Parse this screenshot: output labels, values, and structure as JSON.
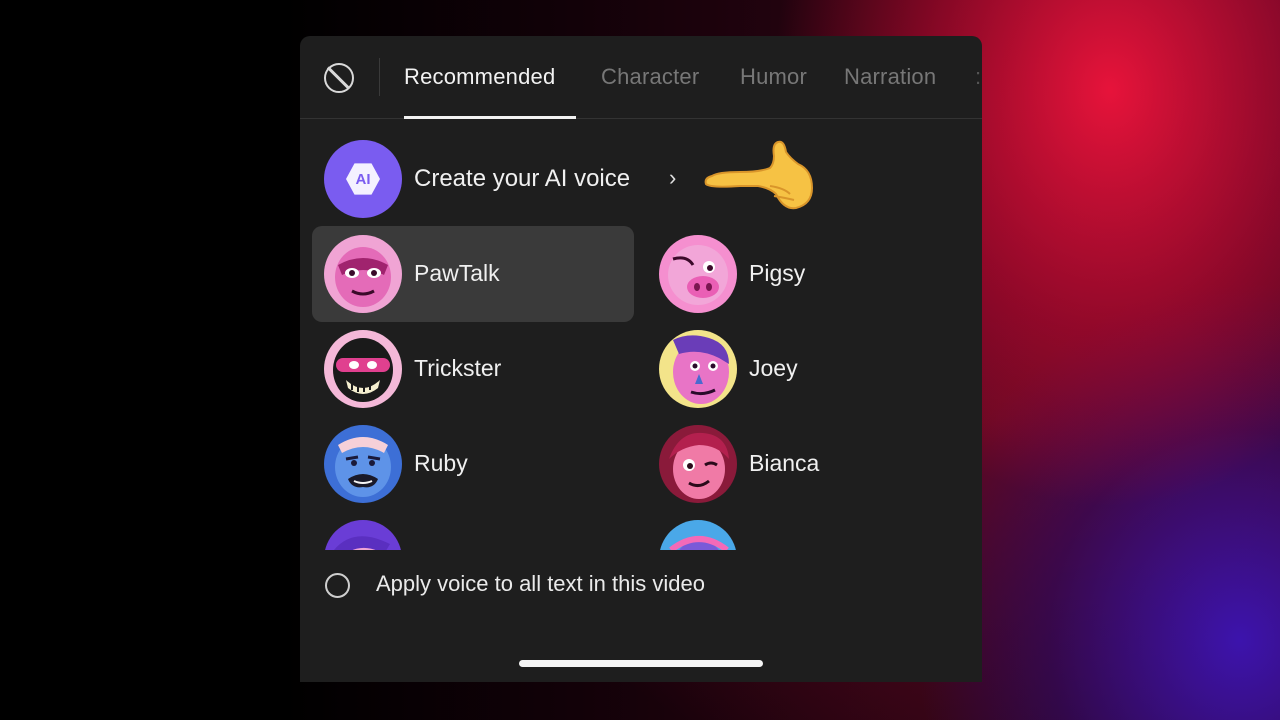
{
  "tabs": {
    "items": [
      {
        "label": "Recommended",
        "active": true
      },
      {
        "label": "Character",
        "active": false
      },
      {
        "label": "Humor",
        "active": false
      },
      {
        "label": "Narration",
        "active": false
      }
    ],
    "more_glyph": ":"
  },
  "ai_voice": {
    "badge": "AI",
    "label": "Create your AI voice",
    "chevron": "›",
    "accent": "#7a5cf0"
  },
  "voices": [
    {
      "label": "PawTalk",
      "selected": true,
      "icon": "pawtalk-avatar-icon"
    },
    {
      "label": "Pigsy",
      "selected": false,
      "icon": "pigsy-avatar-icon"
    },
    {
      "label": "Trickster",
      "selected": false,
      "icon": "trickster-avatar-icon"
    },
    {
      "label": "Joey",
      "selected": false,
      "icon": "joey-avatar-icon"
    },
    {
      "label": "Ruby",
      "selected": false,
      "icon": "ruby-avatar-icon"
    },
    {
      "label": "Bianca",
      "selected": false,
      "icon": "bianca-avatar-icon"
    }
  ],
  "apply_all": {
    "label": "Apply voice to all text in this video",
    "checked": false
  },
  "colors": {
    "panel_bg": "#1e1e1e",
    "selected_item_bg": "#3a3a3a",
    "text": "#f0f0f0",
    "inactive_tab": "#777777"
  }
}
